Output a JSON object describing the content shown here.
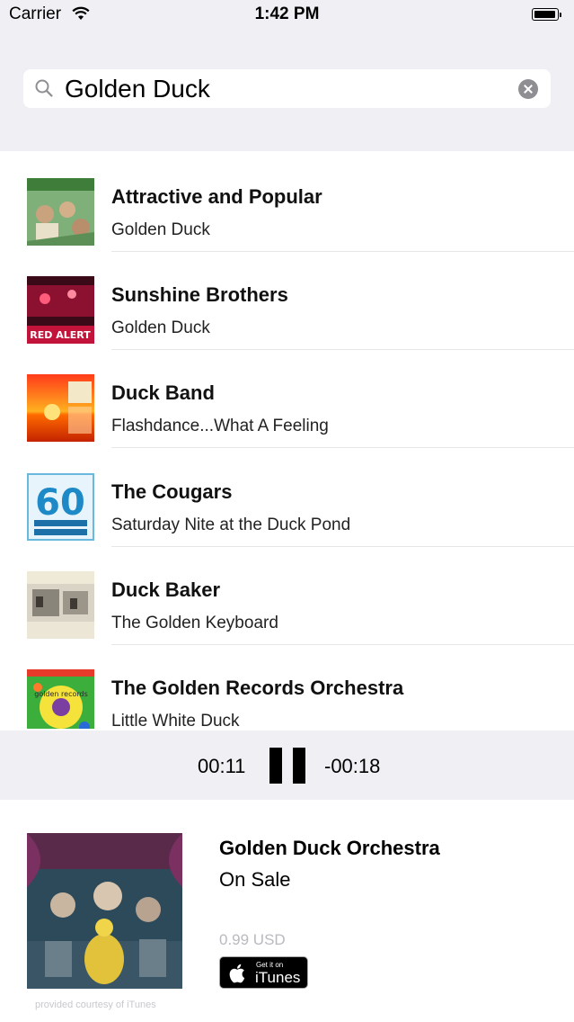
{
  "status_bar": {
    "carrier": "Carrier",
    "time": "1:42 PM",
    "wifi_icon": "wifi-icon",
    "battery_icon": "battery-icon"
  },
  "search": {
    "value": "Golden Duck",
    "search_icon": "magnifier-icon",
    "clear_icon": "clear-x-icon"
  },
  "results": [
    {
      "title": "Attractive and Popular",
      "subtitle": "Golden Duck",
      "art": "album-art"
    },
    {
      "title": "Sunshine Brothers",
      "subtitle": "Golden Duck",
      "art": "album-art",
      "art_text": "RED ALERT"
    },
    {
      "title": "Duck Band",
      "subtitle": "Flashdance...What A Feeling",
      "art": "album-art"
    },
    {
      "title": "The Cougars",
      "subtitle": "Saturday Nite at the Duck Pond",
      "art": "album-art",
      "art_text": "60"
    },
    {
      "title": "Duck Baker",
      "subtitle": "The Golden Keyboard",
      "art": "album-art"
    },
    {
      "title": "The Golden Records Orchestra",
      "subtitle": "Little White Duck",
      "art": "album-art",
      "art_text": "golden records"
    }
  ],
  "player": {
    "elapsed": "00:11",
    "remaining": "-00:18",
    "pause_icon": "pause-icon"
  },
  "detail": {
    "title": "Golden Duck Orchestra",
    "status": "On Sale",
    "price": "0.99 USD",
    "badge_small": "Get it on",
    "badge_big": "iTunes",
    "courtesy": "provided courtesy of iTunes"
  },
  "colors": {
    "header_bg": "#efeff4",
    "list_bg": "#ffffff",
    "price_gray": "#b9b9bf"
  }
}
